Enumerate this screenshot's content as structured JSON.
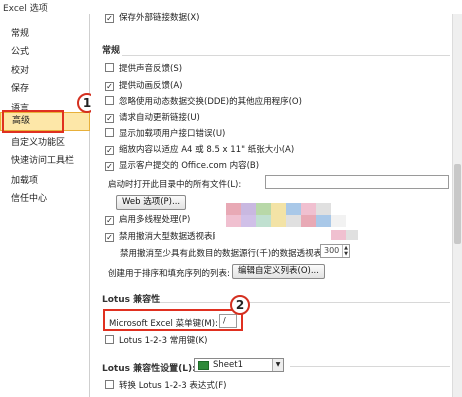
{
  "window": {
    "title": "Excel 选项"
  },
  "sidebar": {
    "items": [
      {
        "label": "常规"
      },
      {
        "label": "公式"
      },
      {
        "label": "校对"
      },
      {
        "label": "保存"
      },
      {
        "label": "语言"
      },
      {
        "label": "高级"
      },
      {
        "label": "自定义功能区"
      },
      {
        "label": "快速访问工具栏"
      },
      {
        "label": "加载项"
      },
      {
        "label": "信任中心"
      }
    ],
    "active_index": 5
  },
  "callouts": {
    "one": "1",
    "two": "2"
  },
  "main": {
    "top_partial": {
      "label": "保存外部链接数据(X)",
      "checked": true
    },
    "general": {
      "heading": "常规",
      "options": [
        {
          "label": "提供声音反馈(S)",
          "checked": false
        },
        {
          "label": "提供动画反馈(A)",
          "checked": true
        },
        {
          "label": "忽略使用动态数据交换(DDE)的其他应用程序(O)",
          "checked": false
        },
        {
          "label": "请求自动更新链接(U)",
          "checked": true
        },
        {
          "label": "显示加载项用户接口错误(U)",
          "checked": false
        },
        {
          "label": "缩放内容以适应 A4 或 8.5 x 11\" 纸张大小(A)",
          "checked": true
        },
        {
          "label": "显示客户提交的 Office.com 内容(B)",
          "checked": true
        }
      ],
      "startup_label": "启动时打开此目录中的所有文件(L):",
      "startup_value": "",
      "web_options_button": "Web 选项(P)...",
      "multithread": {
        "label": "启用多线程处理(P)",
        "checked": true
      },
      "pivot_undo": {
        "label": "禁用撤消大型数据透视表刷新操作以减少刷新时间",
        "checked": true
      },
      "pivot_rows_label": "禁用撤消至少具有此数目的数据源行(千)的数据透视表:",
      "pivot_rows_value": "300",
      "sort_lists_label": "创建用于排序和填充序列的列表:",
      "custom_lists_button": "编辑自定义列表(O)..."
    },
    "lotus": {
      "heading": "Lotus 兼容性",
      "menu_key_label": "Microsoft Excel 菜单键(M):",
      "menu_key_value": "/",
      "nav_keys": {
        "label": "Lotus 1-2-3 常用键(K)",
        "checked": false
      }
    },
    "lotus_settings": {
      "heading_label": "Lotus 兼容性设置(L):",
      "sheet_value": "Sheet1",
      "transition_formula": {
        "label": "转换 Lotus 1-2-3 表达式(F)",
        "checked": false
      }
    }
  },
  "colors": {
    "active_nav_bg": "#fde7a8",
    "highlight_red": "#e03020",
    "watermark": [
      "#e8a9b5",
      "#c9b8e0",
      "#b8d8a8",
      "#f3e3a6",
      "#a9c8e8",
      "#f0c0d0",
      "#d0c0e8",
      "#c0e0d0",
      "#e0e0e0"
    ]
  }
}
